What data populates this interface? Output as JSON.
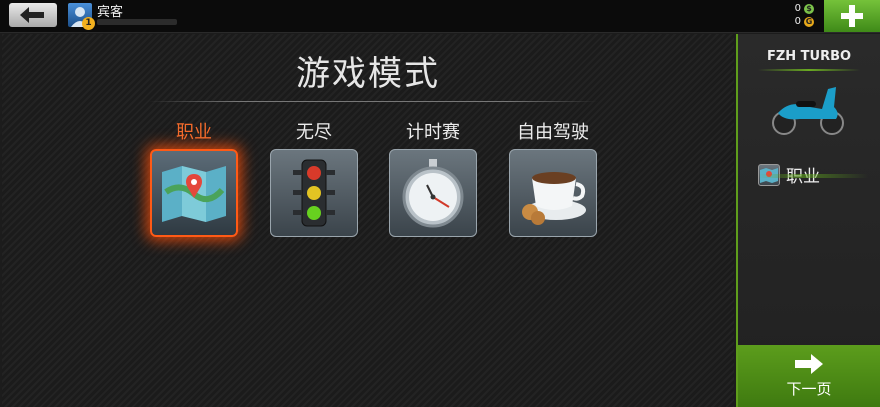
{
  "header": {
    "username": "宾客",
    "level": "1",
    "cash": "0",
    "gold": "0",
    "cash_icon": "dollar-coin-icon",
    "gold_icon": "gold-coin-icon"
  },
  "main": {
    "title": "游戏模式",
    "modes": [
      {
        "label": "职业",
        "icon": "map-pin-icon",
        "selected": true
      },
      {
        "label": "无尽",
        "icon": "traffic-light-icon",
        "selected": false
      },
      {
        "label": "计时赛",
        "icon": "stopwatch-icon",
        "selected": false
      },
      {
        "label": "自由驾驶",
        "icon": "coffee-cup-icon",
        "selected": false
      }
    ]
  },
  "side": {
    "vehicle_name": "FZH TURBO",
    "vehicle_icon": "scooter-icon",
    "selected_mode": "职业",
    "next_label": "下一页"
  },
  "colors": {
    "accent_green": "#5f9e1c",
    "selected_orange": "#ff5a16"
  }
}
